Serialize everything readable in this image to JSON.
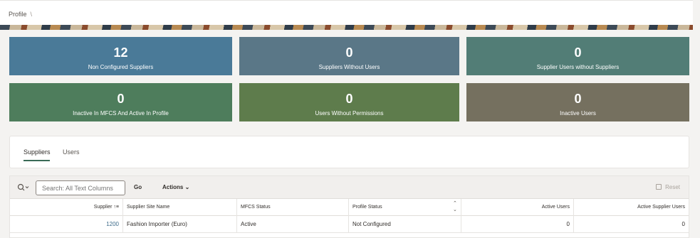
{
  "breadcrumb": {
    "label": "Profile",
    "separator": "\\"
  },
  "tiles": [
    {
      "value": "12",
      "label": "Non Configured Suppliers",
      "color": "#4a7a98"
    },
    {
      "value": "0",
      "label": "Suppliers Without Users",
      "color": "#5a7787"
    },
    {
      "value": "0",
      "label": "Supplier Users without Suppliers",
      "color": "#527d76"
    },
    {
      "value": "0",
      "label": "Inactive In MFCS And Active In Profile",
      "color": "#4e7d5c"
    },
    {
      "value": "0",
      "label": "Users Without Permissions",
      "color": "#5e7c4c"
    },
    {
      "value": "0",
      "label": "Inactive Users",
      "color": "#75705f"
    }
  ],
  "tabs": [
    {
      "label": "Suppliers"
    },
    {
      "label": "Users"
    }
  ],
  "toolbar": {
    "search_placeholder": "Search: All Text Columns",
    "go_label": "Go",
    "actions_label": "Actions",
    "reset_label": "Reset"
  },
  "columns": {
    "supplier": "Supplier",
    "site_name": "Supplier Site Name",
    "mfcs_status": "MFCS Status",
    "profile_status": "Profile Status",
    "active_users": "Active Users",
    "active_supplier_users": "Active Supplier Users"
  },
  "rows": [
    {
      "supplier": "1200",
      "site_name": "Fashion Importer (Euro)",
      "mfcs_status": "Active",
      "profile_status": "Not Configured",
      "active_users": "0",
      "active_supplier_users": "0"
    }
  ]
}
